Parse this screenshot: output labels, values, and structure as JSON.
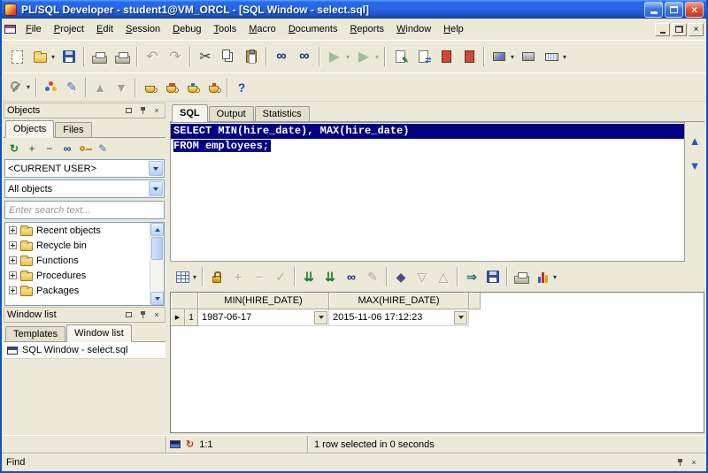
{
  "window": {
    "title": "PL/SQL Developer - student1@VM_ORCL - [SQL Window - select.sql]"
  },
  "menu": {
    "items": [
      "File",
      "Project",
      "Edit",
      "Session",
      "Debug",
      "Tools",
      "Macro",
      "Documents",
      "Reports",
      "Window",
      "Help"
    ]
  },
  "icons": {
    "undo": "↶",
    "redo": "↷",
    "cut": "✂",
    "find": "∞",
    "find_next": "∞",
    "run": "▶",
    "run_alt": "▶",
    "pencil": "✎",
    "swap": "⇄",
    "help": "?",
    "refresh": "↻",
    "expand": "+",
    "collapse": "−",
    "check": "✓",
    "fetch_next": "⇊",
    "fetch_all": "⇊",
    "record_view": "◆",
    "sort_desc": "▽",
    "sort_asc": "△",
    "export": "⇒",
    "nav_up": "▲",
    "nav_down": "▼",
    "row_marker": "▶",
    "close": "×",
    "status_refresh": "↻"
  },
  "objects_panel": {
    "title": "Objects",
    "tabs": [
      "Objects",
      "Files"
    ],
    "user_filter": "<CURRENT USER>",
    "object_filter": "All objects",
    "search_placeholder": "Enter search text...",
    "tree": [
      "Recent objects",
      "Recycle bin",
      "Functions",
      "Procedures",
      "Packages"
    ]
  },
  "window_list_panel": {
    "title": "Window list",
    "tabs": [
      "Templates",
      "Window list"
    ],
    "items": [
      "SQL Window - select.sql"
    ]
  },
  "editor": {
    "tabs": [
      "SQL",
      "Output",
      "Statistics"
    ],
    "code": [
      "SELECT MIN(hire_date), MAX(hire_date)",
      "FROM employees;"
    ]
  },
  "results": {
    "columns": [
      "MIN(HIRE_DATE)",
      "MAX(HIRE_DATE)"
    ],
    "rows": [
      [
        "1",
        "1987-06-17",
        "2015-11-06 17:12:23"
      ]
    ]
  },
  "statusbar": {
    "position": "1:1",
    "message": "1 row selected in 0 seconds"
  },
  "findbar": {
    "label": "Find"
  }
}
